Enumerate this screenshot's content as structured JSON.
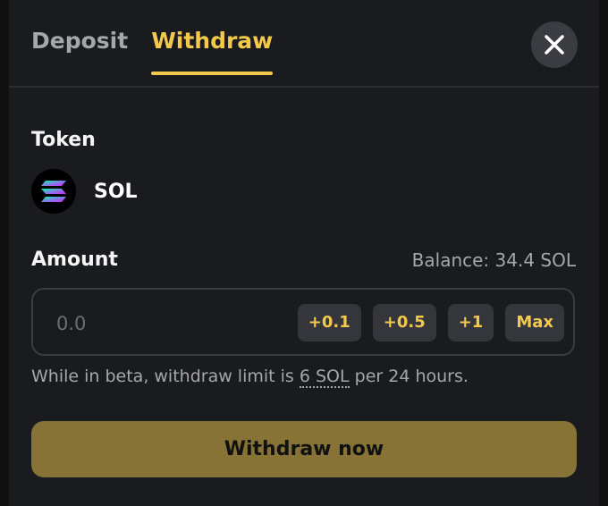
{
  "tabs": [
    {
      "label": "Deposit",
      "active": false
    },
    {
      "label": "Withdraw",
      "active": true
    }
  ],
  "close": {
    "icon": "close-icon"
  },
  "token": {
    "label": "Token",
    "name": "SOL",
    "icon": "solana-icon"
  },
  "amount": {
    "label": "Amount",
    "balance": "Balance: 34.4 SOL",
    "placeholder": "0.0",
    "quick_buttons": [
      "+0.1",
      "+0.5",
      "+1",
      "Max"
    ]
  },
  "note": {
    "prefix": "While in beta, withdraw limit is ",
    "limit": "6 SOL",
    "suffix": " per 24 hours."
  },
  "action": {
    "label": "Withdraw now"
  },
  "colors": {
    "accent": "#f2c94c",
    "button_bg": "#877336",
    "panel_bg": "#1a1b1e"
  }
}
